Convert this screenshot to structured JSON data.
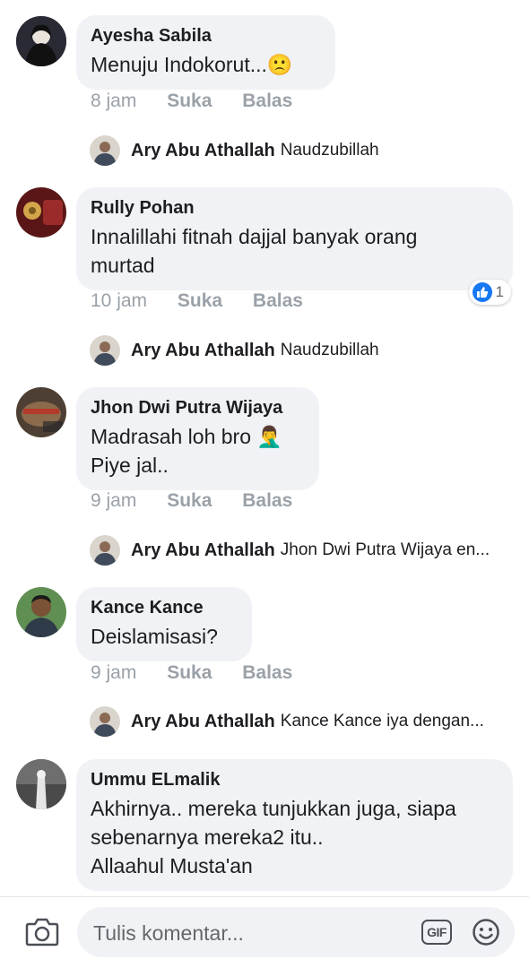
{
  "comments": [
    {
      "author": "Ayesha Sabila",
      "text_lines": [
        "Menuju Indokorut...🙁"
      ],
      "time": "8 jam",
      "like": "Suka",
      "reply": "Balas",
      "avatar_color": "#2a2a35",
      "reply_preview": {
        "author": "Ary Abu Athallah",
        "text": "Naudzubillah"
      }
    },
    {
      "author": "Rully Pohan",
      "text_lines": [
        "Innalillahi fitnah dajjal banyak orang",
        "murtad"
      ],
      "time": "10 jam",
      "like": "Suka",
      "reply": "Balas",
      "avatar_color": "#6b1f1f",
      "reaction_count": "1",
      "reply_preview": {
        "author": "Ary Abu Athallah",
        "text": "Naudzubillah"
      }
    },
    {
      "author": "Jhon Dwi Putra Wijaya",
      "text_lines": [
        "Madrasah loh bro 🤦‍♂️",
        "Piye jal.."
      ],
      "time": "9 jam",
      "like": "Suka",
      "reply": "Balas",
      "avatar_color": "#5a4a3a",
      "reply_preview": {
        "author": "Ary Abu Athallah",
        "text": "Jhon Dwi Putra Wijaya en..."
      }
    },
    {
      "author": "Kance Kance",
      "text_lines": [
        "Deislamisasi?"
      ],
      "time": "9 jam",
      "like": "Suka",
      "reply": "Balas",
      "avatar_color": "#4e7a46",
      "reply_preview": {
        "author": "Ary Abu Athallah",
        "text": "Kance Kance iya dengan..."
      }
    },
    {
      "author": "Ummu ELmalik",
      "text_lines": [
        "Akhirnya.. mereka tunjukkan juga, siapa",
        "sebenarnya mereka2 itu..",
        "Allaahul Musta'an"
      ],
      "avatar_color": "#3a3a3a"
    }
  ],
  "composer": {
    "placeholder": "Tulis komentar...",
    "gif_label": "GIF",
    "camera_icon": "camera-icon",
    "emoji_icon": "emoji-icon"
  },
  "colors": {
    "bubble": "#f0f2f5",
    "meta_text": "#9aa1a8",
    "like_blue": "#1877f2"
  }
}
